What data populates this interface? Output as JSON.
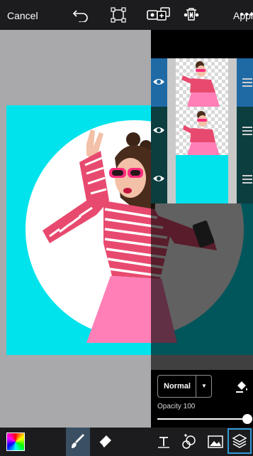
{
  "topbar": {
    "cancel_label": "Cancel",
    "apply_label": "Apply",
    "icons": [
      "undo-icon",
      "crop-icon",
      "video-record-icon",
      "more-icon"
    ]
  },
  "canvas": {
    "background_color": "#a9a9ab",
    "backdrop_color": "#00e3ec",
    "circle_color": "#ffffff"
  },
  "layers_panel": {
    "toolbar_icons": [
      "duplicate-layer-icon",
      "trash-icon",
      "more-icon"
    ],
    "layers": [
      {
        "name": "subject-cutout",
        "visible": true,
        "selected": true,
        "thumb": "checker"
      },
      {
        "name": "subject-duplicate",
        "visible": true,
        "selected": false,
        "thumb": "checker"
      },
      {
        "name": "background-cyan",
        "visible": true,
        "selected": false,
        "thumb": "solid-cyan"
      }
    ],
    "selected_color": "#1f6aa5"
  },
  "blend": {
    "mode": "Normal",
    "opacity_label": "Opacity 100",
    "opacity_value": 100
  },
  "bottom_toolbar": {
    "tools": [
      "color-picker",
      "brush",
      "eraser",
      "text",
      "clone",
      "image",
      "layers"
    ],
    "active": "layers",
    "accent": "#2f9bd8"
  }
}
